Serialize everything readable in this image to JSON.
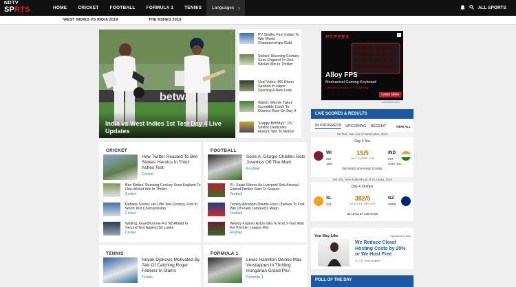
{
  "nav": {
    "logo_top": "NDTV",
    "logo_a": "SP",
    "logo_b": "RTS",
    "items": [
      "HOME",
      "CRICKET",
      "FOOTBALL",
      "FORMULA 1",
      "TENNIS"
    ],
    "more": "• • •",
    "language": "Languages",
    "all_sports": "ALL SPORTS"
  },
  "subnav": [
    "WEST INDIES VS INDIA 2019",
    "THE ASHES 2019"
  ],
  "hero": {
    "title": "India vs West Indies 1st Test Day 4 Live Updates"
  },
  "side_stories": [
    "PV Sindhu First Indian To Win World Championships Gold",
    "Stokes' Stunning Century Sees England To One-Wicket Win In Thriller",
    "Viral Video: MS Dhoni Spotted In Jaipur Sporting A New Look",
    "Watch: Warner Takes Incredible Catch To Dismiss Root On Day 4",
    "\"Happy Birthday\": PV Sindhu Dedicates Historic Win To Mother"
  ],
  "cricket": {
    "heading": "CRICKET",
    "lead": {
      "title": "How Twitter Reacted To Ben Stokes' Heroics In Third Ashes Test",
      "tag": "Cricket"
    },
    "items": [
      {
        "title": "Ben Stokes' Stunning Century Sees England To One-Wicket Win In Thriller",
        "tag": "Cricket"
      },
      {
        "title": "Rahane Scores His 10th Test Century, First In World Test Championship",
        "tag": "Cricket"
      },
      {
        "title": "Watling, Grandhomme Put NZ Ahead In Second Test Against Sri Lanka",
        "tag": "Cricket"
      }
    ]
  },
  "football": {
    "heading": "FOOTBALL",
    "lead": {
      "title": "Serie A: Giorgio Chiellini Gets Juventus Off The Mark",
      "tag": "Football"
    },
    "items": [
      {
        "title": "PL: Salah Shines As Liverpool Sink Arsenal, Extend Perfect Start To Season",
        "tag": "Football"
      },
      {
        "title": "Tammy Abraham Double Fires Chelsea To First Win Of Frank Lampard's Reign",
        "tag": "Football"
      },
      {
        "title": "Wesley Inspires Aston Villa To End 3-Year Wait For Premier League Win",
        "tag": "Football"
      }
    ]
  },
  "tennis": {
    "heading": "TENNIS",
    "lead": {
      "title": "Novak Djokovic Motivated By Talk Of Catching Roger Federer In Slams",
      "tag": "Tennis"
    }
  },
  "formula1": {
    "heading": "FORMULA 1",
    "lead": {
      "title": "Lewis Hamilton Denies Max Verstappen In Thrilling Hungarian Grand Prix",
      "tag": "Formula 1"
    }
  },
  "ad": {
    "brand": "HYPERX",
    "product": "Alloy FPS",
    "subtitle": "Mechanical Gaming Keyboard",
    "tag": "Compact and ideal for FPS gaming",
    "cta": "Learn More",
    "label": "Advertisement"
  },
  "live": {
    "title": "LIVE SCORES & RESULTS",
    "tabs": [
      "IN PROGRESS",
      "UPCOMING",
      "RECENT"
    ],
    "view_all": "VIEW ALL",
    "matches": [
      {
        "caption": "1st Test, India tour of West Indies, 2019",
        "status": "Day 4 Tea",
        "team1": "WI",
        "team1_score": "222",
        "team1_score2": "15/5",
        "team2": "IND",
        "team2_score": "297",
        "team2_score2": "343/7 dec",
        "score": "15/5",
        "score_sub": "Ov 7.3 | CRR: 2.00",
        "note": "IND NEED 404 RUNS TO WIN",
        "colors": {
          "team1": "#7a1f2b",
          "team2": "#ff9933"
        }
      },
      {
        "caption": "2nd Test, New Zealand tour of Sri Lanka, 2019",
        "status": "Day 4 Stumps",
        "team1": "SL",
        "team1_score": "244",
        "team1_score2": "",
        "team2": "NZ",
        "team2_score": "382/5",
        "team2_score2": "",
        "score": "382/5",
        "score_sub": "Ov 113.0 | CRR: 3.47",
        "note": "NZ LEAD BY 138 RUNS",
        "colors": {
          "team1": "#f4a21a",
          "team2": "#00247d"
        }
      }
    ]
  },
  "may_like": {
    "heading": "You May Like",
    "sponsored": "Sponsored Links",
    "title": "We Reduce Cloud Hosting Costs by 20% or We Host Free",
    "source": "CT CE Technologies"
  },
  "poll": {
    "title": "POLL OF THE DAY"
  },
  "icons": [
    "menu-icon",
    "bell-icon",
    "search-icon",
    "chevron-right-icon",
    "more-icon"
  ],
  "colors": {
    "brand_red": "#e31b23",
    "accent_blue": "#1b5aa3",
    "tag_blue": "#2a7bbf"
  }
}
